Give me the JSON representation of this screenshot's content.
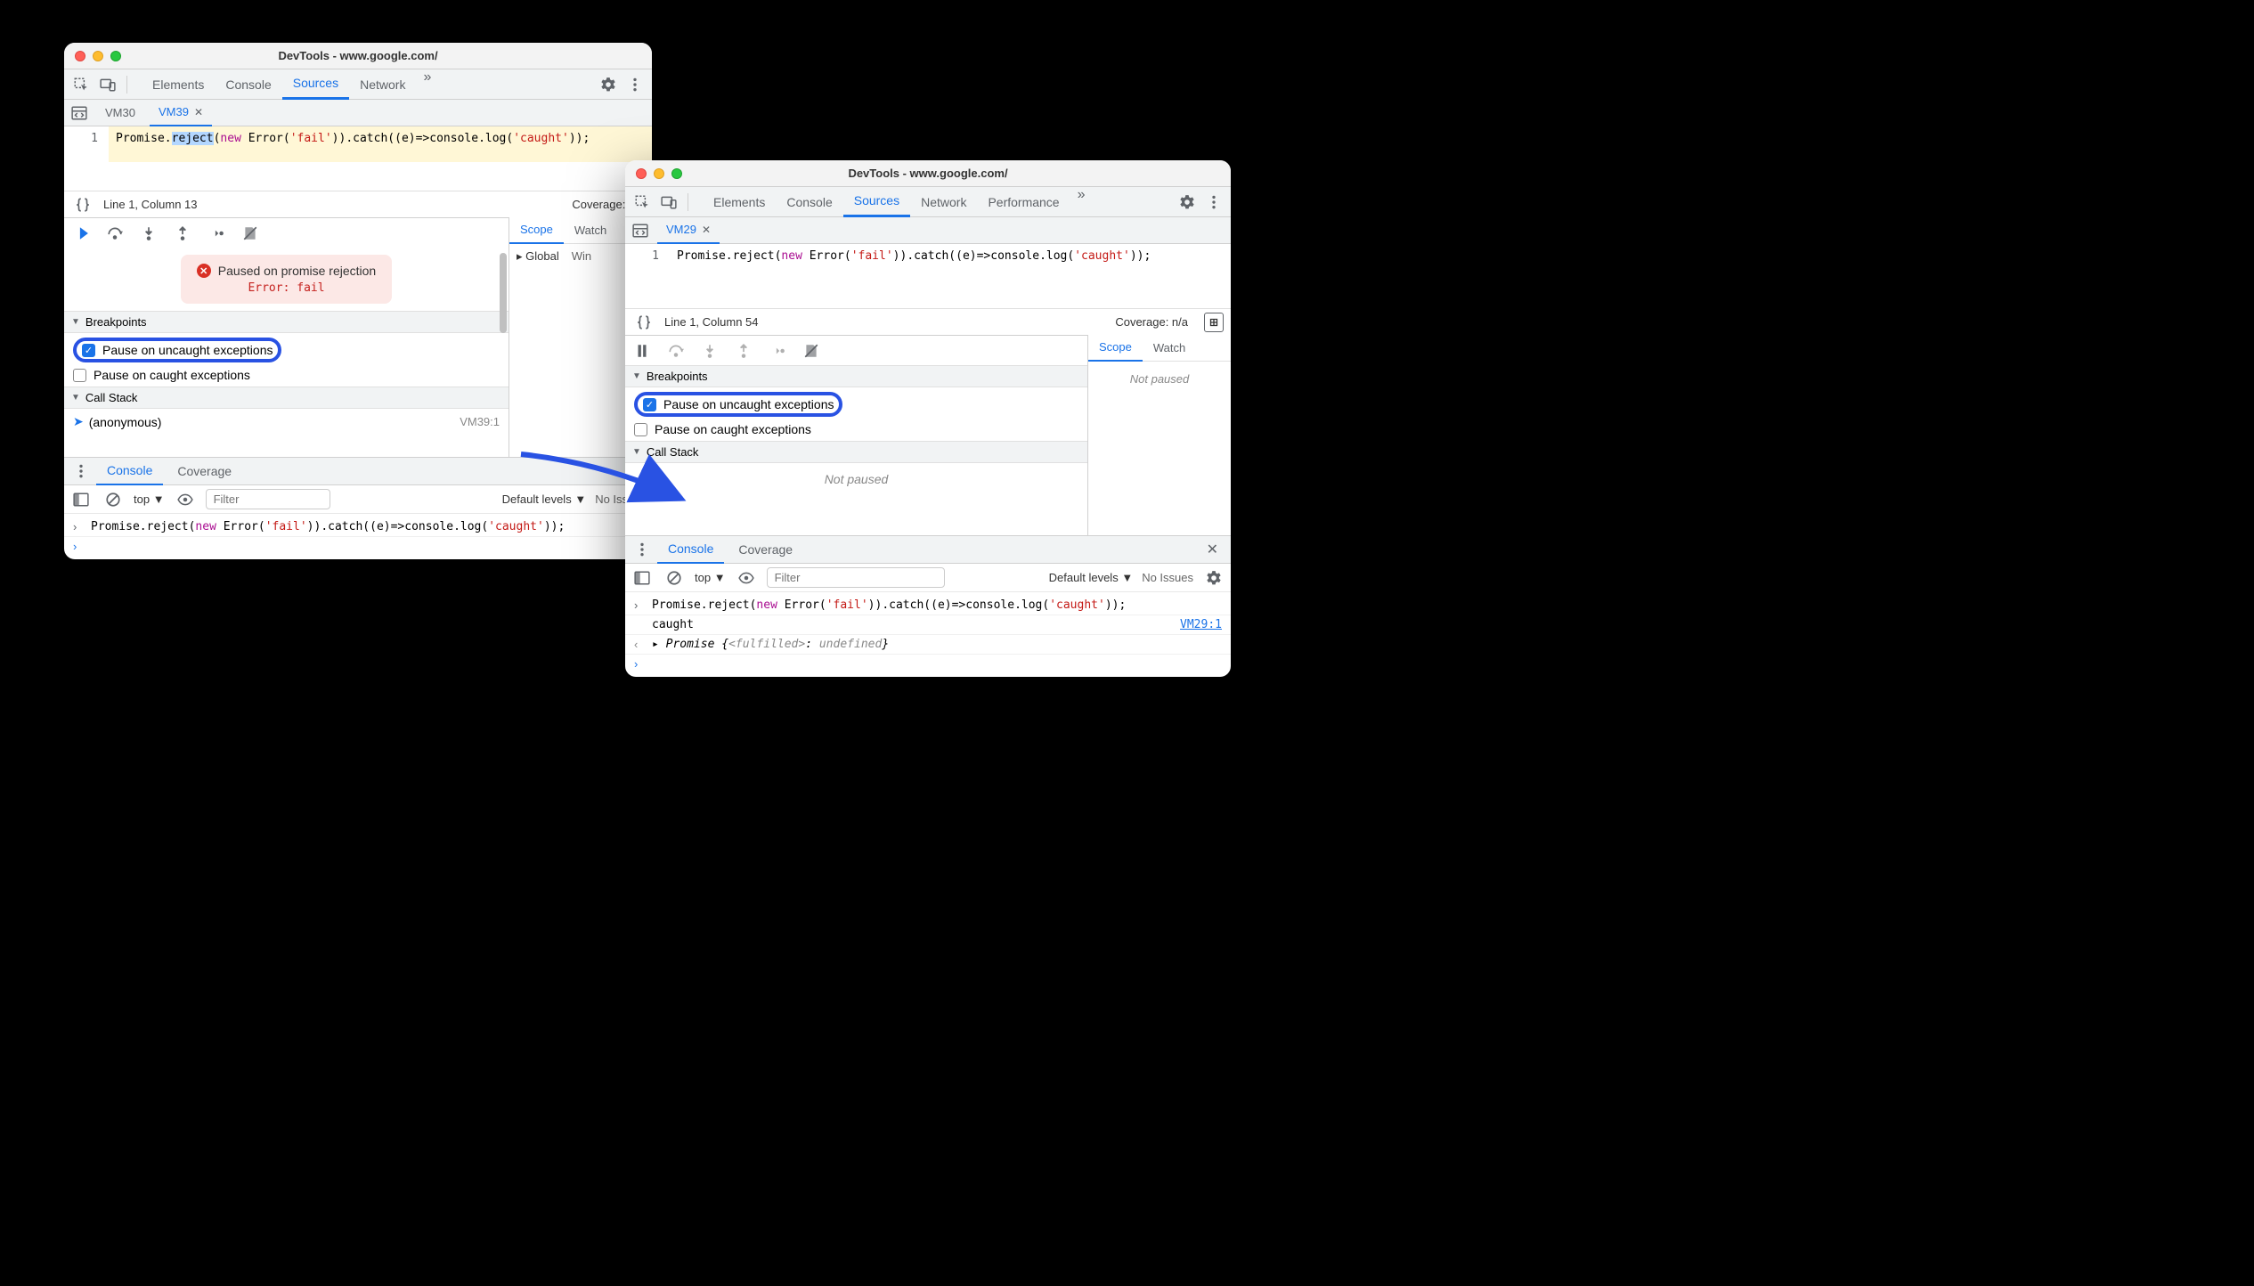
{
  "left": {
    "title": "DevTools - www.google.com/",
    "tabs": [
      "Elements",
      "Console",
      "Sources",
      "Network"
    ],
    "active_tab": "Sources",
    "files": [
      {
        "name": "VM30",
        "active": false
      },
      {
        "name": "VM39",
        "active": true
      }
    ],
    "code": {
      "line_no": "1",
      "tokens": {
        "promise": "Promise",
        "reject": "reject",
        "new": "new",
        "error": "Error",
        "fail": "'fail'",
        "catch": "catch",
        "e": "e",
        "console": "console",
        "log": "log",
        "caught": "'caught'"
      },
      "status": "Line 1, Column 13",
      "coverage": "Coverage: n/a"
    },
    "scope": {
      "tabs": [
        "Scope",
        "Watch"
      ],
      "row_label": "Global",
      "row_value": "Win"
    },
    "paused": {
      "title": "Paused on promise rejection",
      "error": "Error: fail"
    },
    "breakpoints": {
      "header": "Breakpoints",
      "uncaught": "Pause on uncaught exceptions",
      "caught": "Pause on caught exceptions"
    },
    "callstack": {
      "header": "Call Stack",
      "frame": "(anonymous)",
      "ref": "VM39:1"
    },
    "drawer": {
      "tabs": [
        "Console",
        "Coverage"
      ],
      "context": "top",
      "filter_placeholder": "Filter",
      "levels": "Default levels",
      "issues": "No Issues"
    },
    "console_lines": {
      "input_code": true
    }
  },
  "right": {
    "title": "DevTools - www.google.com/",
    "tabs": [
      "Elements",
      "Console",
      "Sources",
      "Network",
      "Performance"
    ],
    "active_tab": "Sources",
    "files": [
      {
        "name": "VM29",
        "active": true
      }
    ],
    "code": {
      "line_no": "1",
      "status": "Line 1, Column 54",
      "coverage": "Coverage: n/a"
    },
    "scope": {
      "tabs": [
        "Scope",
        "Watch"
      ],
      "body": "Not paused"
    },
    "breakpoints": {
      "header": "Breakpoints",
      "uncaught": "Pause on uncaught exceptions",
      "caught": "Pause on caught exceptions"
    },
    "callstack": {
      "header": "Call Stack",
      "body": "Not paused"
    },
    "drawer": {
      "tabs": [
        "Console",
        "Coverage"
      ],
      "context": "top",
      "filter_placeholder": "Filter",
      "levels": "Default levels",
      "issues": "No Issues"
    },
    "console": {
      "out_caught": "caught",
      "out_link": "VM29:1",
      "promise_line": {
        "prefix": "Promise ",
        "brace_open": "{",
        "fulfilled": "<fulfilled>",
        "colon": ": ",
        "undefined": "undefined",
        "brace_close": "}"
      }
    }
  },
  "shared_code": {
    "promise": "Promise",
    "reject": "reject",
    "new": "new",
    "error": "Error",
    "fail": "'fail'",
    "catch": "catch",
    "e": "e",
    "arrow": "=>",
    "console": "console",
    "log": "log",
    "caught": "'caught'"
  }
}
